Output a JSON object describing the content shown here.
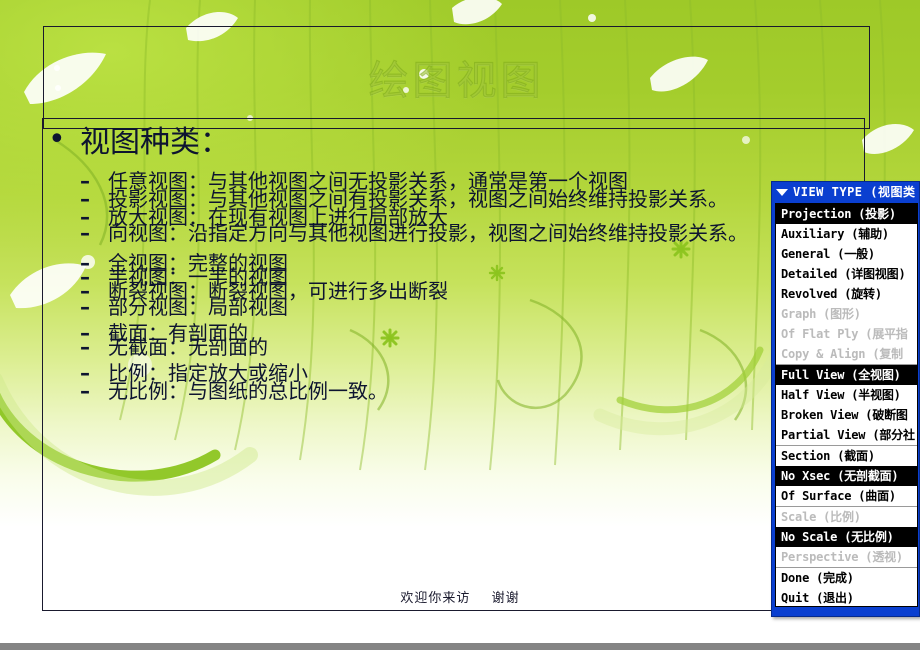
{
  "slide": {
    "title": "绘图视图",
    "heading": "视图种类：",
    "groups": [
      {
        "items": [
          "任意视图：与其他视图之间无投影关系，通常是第一个视图",
          "投影视图：与其他视图之间有投影关系，视图之间始终维持投影关系。",
          "放大视图：在现有视图上进行局部放大",
          "向视图：沿指定方向与其他视图进行投影，视图之间始终维持投影关系。"
        ]
      },
      {
        "items": [
          "全视图：完整的视图",
          "半视图：一半的视图",
          "断裂视图：断裂视图，可进行多出断裂",
          "部分视图：局部视图"
        ]
      },
      {
        "items": [
          "截面：有剖面的",
          "无截面：无剖面的"
        ]
      },
      {
        "items": [
          "比例：指定放大或缩小",
          "无比例：与图纸的总比例一致。"
        ]
      }
    ],
    "footer_left": "欢迎你来访",
    "footer_right": "谢谢"
  },
  "dialog": {
    "title": "VIEW TYPE (视图类",
    "title_icon": "triangle-down-icon",
    "items": [
      {
        "label": "Projection (投影)",
        "state": "selected"
      },
      {
        "label": "Auxiliary (辅助)",
        "state": "normal"
      },
      {
        "label": "General (一般)",
        "state": "normal"
      },
      {
        "label": "Detailed (详图视图)",
        "state": "normal"
      },
      {
        "label": "Revolved (旋转)",
        "state": "normal"
      },
      {
        "label": "Graph (图形)",
        "state": "disabled"
      },
      {
        "label": "Of Flat Ply (展平指",
        "state": "disabled"
      },
      {
        "label": "Copy & Align (复制",
        "state": "disabled"
      },
      {
        "label": "Full View (全视图)",
        "state": "selected",
        "separator": true
      },
      {
        "label": "Half View (半视图)",
        "state": "normal"
      },
      {
        "label": "Broken View (破断图",
        "state": "normal"
      },
      {
        "label": "Partial View (部分社",
        "state": "normal"
      },
      {
        "label": "Section (截面)",
        "state": "normal",
        "separator": true
      },
      {
        "label": "No Xsec (无剖截面)",
        "state": "selected"
      },
      {
        "label": "Of Surface (曲面)",
        "state": "normal"
      },
      {
        "label": "Scale (比例)",
        "state": "disabled",
        "separator": true
      },
      {
        "label": "No Scale (无比例)",
        "state": "selected"
      },
      {
        "label": "Perspective (透视)",
        "state": "disabled"
      },
      {
        "label": "Done (完成)",
        "state": "normal",
        "separator": true
      },
      {
        "label": "Quit (退出)",
        "state": "normal"
      }
    ]
  },
  "colors": {
    "dialog_titlebar": "#0a3fd0",
    "dialog_selected_bg": "#000000",
    "dialog_disabled_text": "#bbbbbb",
    "slide_bg_top": "#9ec928",
    "slide_bg_bottom": "#ffffff",
    "body_text": "#0d1430",
    "bottom_bar": "#848484"
  }
}
